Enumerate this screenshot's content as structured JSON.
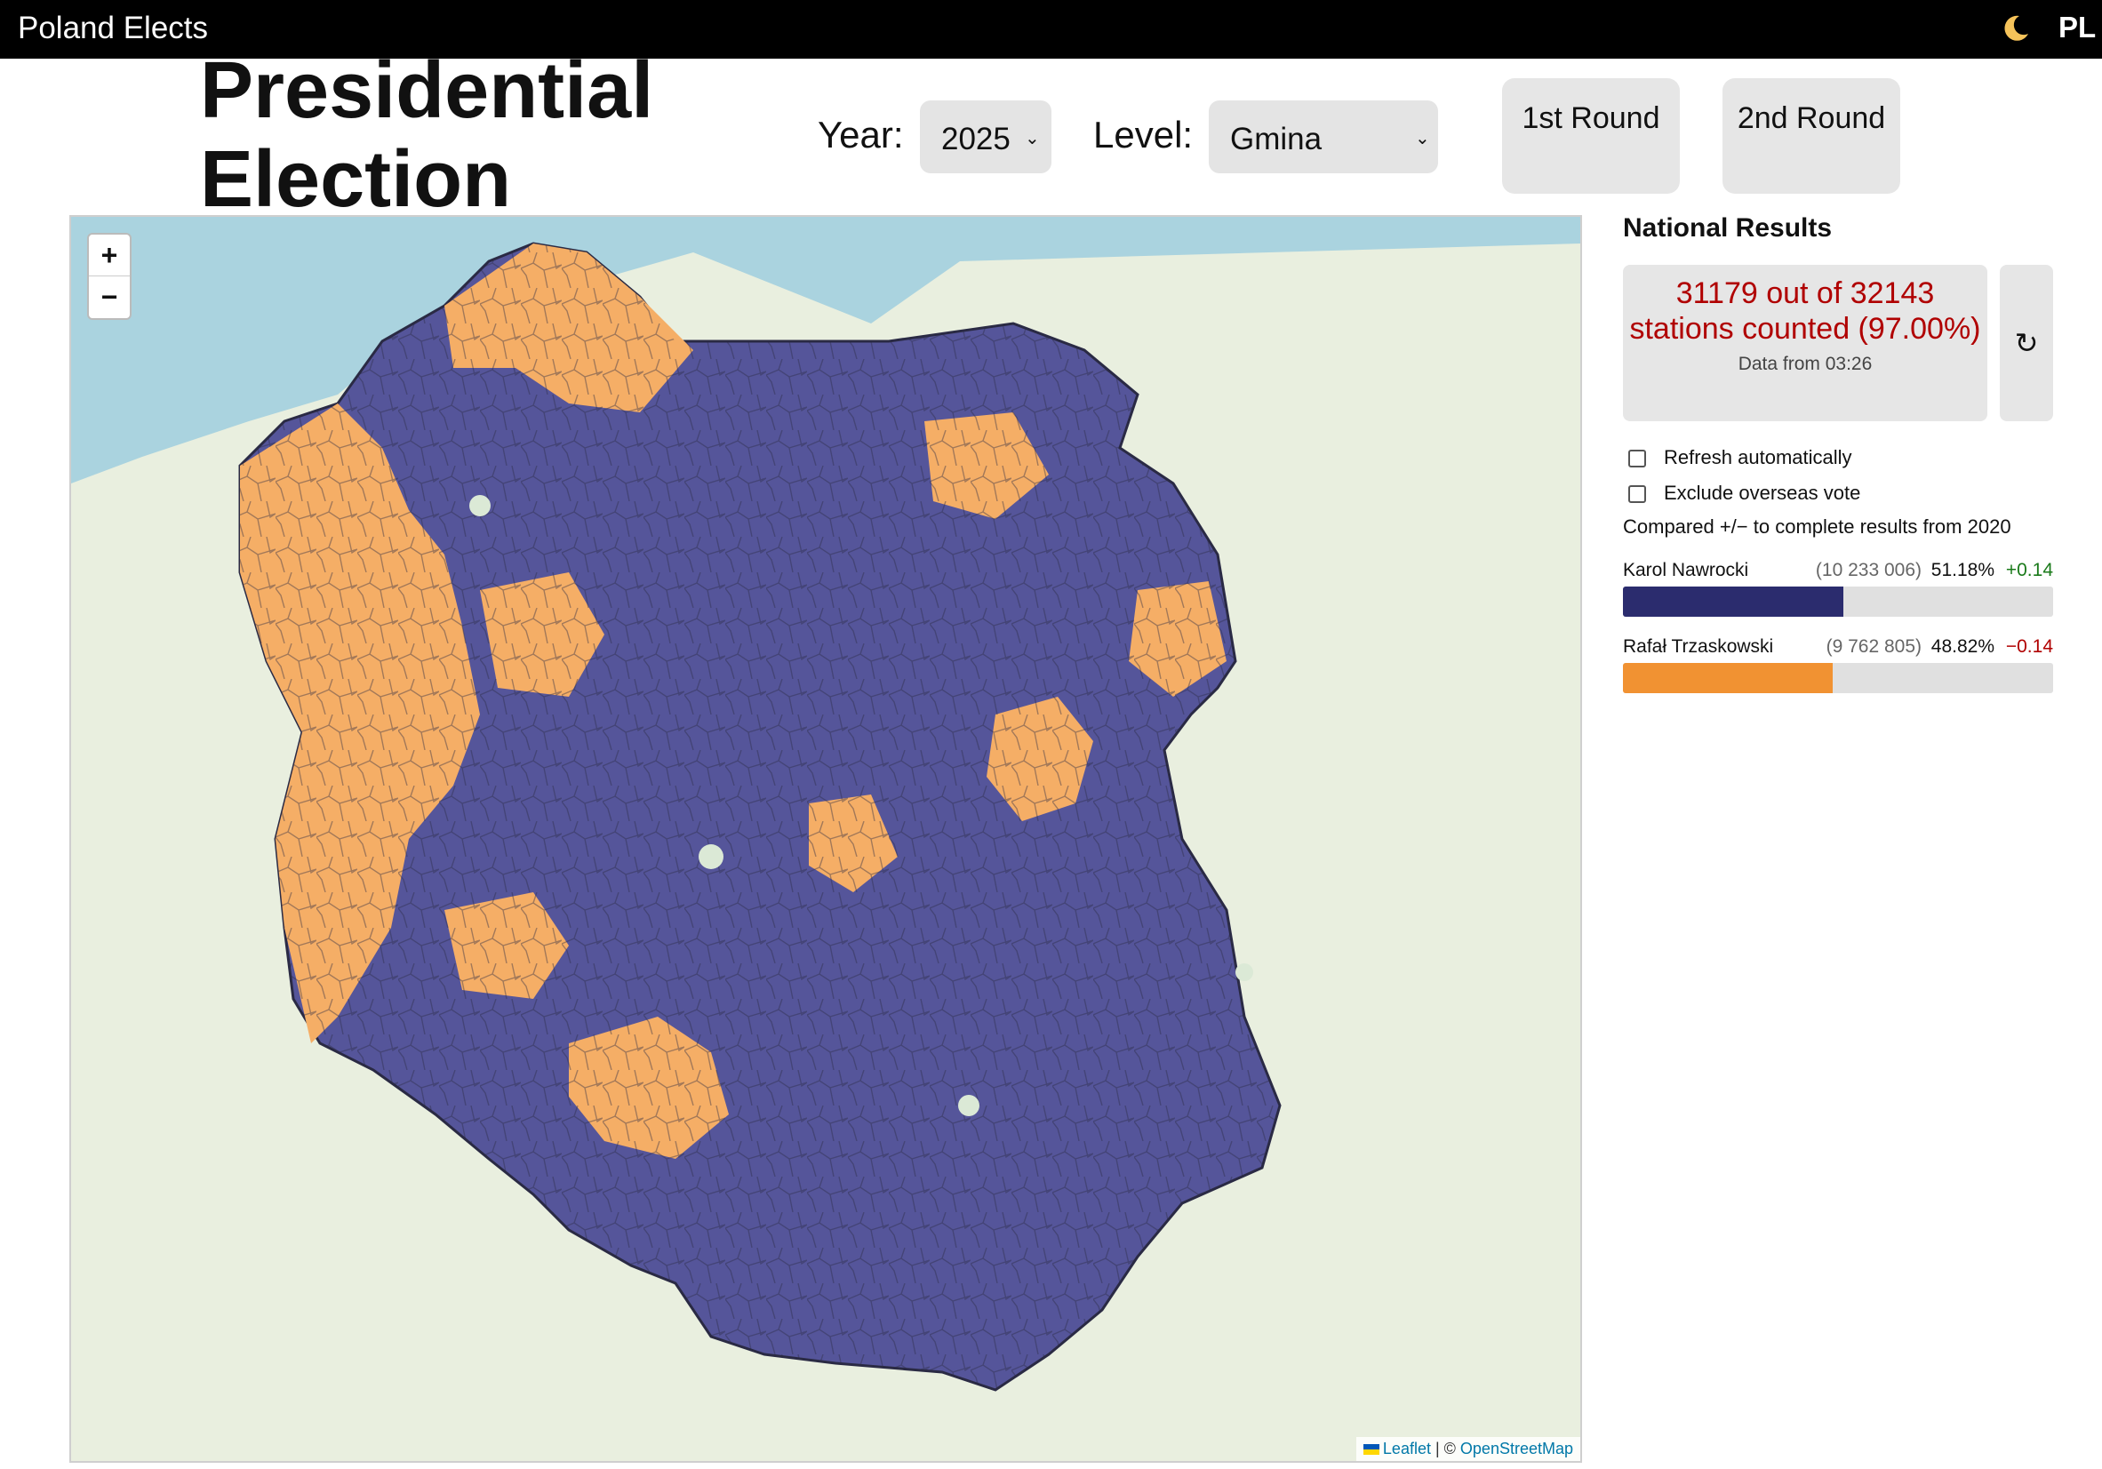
{
  "app": {
    "title": "Poland Elects",
    "language": "PL"
  },
  "page_title": "Presidential Election 2025",
  "controls": {
    "year_label": "Year:",
    "year_value": "2025",
    "level_label": "Level:",
    "level_value": "Gmina",
    "round1_label": "1st Round",
    "round2_label": "2nd Round"
  },
  "map": {
    "zoom_in": "+",
    "zoom_out": "−",
    "attribution_leaflet": "Leaflet",
    "attribution_sep": " | © ",
    "attribution_osm": "OpenStreetMap",
    "region_colors": {
      "nawrocki": "#4a4a8f",
      "trzaskowski": "#f5ae66",
      "neutral": "#dbe9d6"
    }
  },
  "sidebar": {
    "title": "National Results",
    "counted_text": "31179 out of 32143 stations counted (97.00%)",
    "data_time": "Data from 03:26",
    "refresh_icon": "↻",
    "refresh_auto_label": "Refresh automatically",
    "exclude_overseas_label": "Exclude overseas vote",
    "compared_text": "Compared +/− to complete results from 2020",
    "candidates": [
      {
        "name": "Karol Nawrocki",
        "votes": "(10 233 006)",
        "percent": "51.18%",
        "change": "+0.14",
        "share": 51.18,
        "color": "#2b2c6e",
        "change_color": "#1a7a1a"
      },
      {
        "name": "Rafał Trzaskowski",
        "votes": "(9 762 805)",
        "percent": "48.82%",
        "change": "−0.14",
        "share": 48.82,
        "color": "#f19232",
        "change_color": "#b00000"
      }
    ]
  }
}
